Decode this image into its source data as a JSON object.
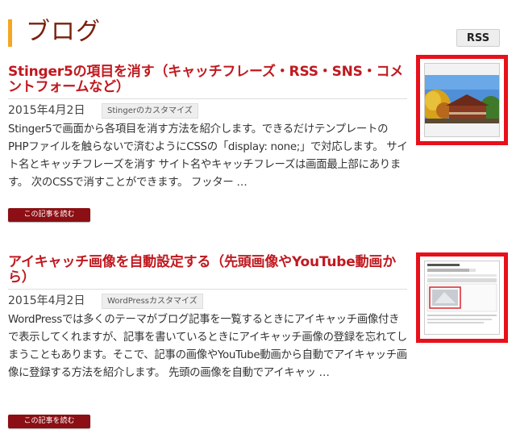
{
  "header": {
    "title": "ブログ",
    "rss_label": "RSS"
  },
  "posts": [
    {
      "title": "Stinger5の項目を消す（キャッチフレーズ・RSS・SNS・コメントフォームなど）",
      "date": "2015年4月2日",
      "category": "Stingerのカスタマイズ",
      "excerpt": "Stinger5で画面から各項目を消す方法を紹介します。できるだけテンプレートのPHPファイルを触らないで済むようにCSSの「display: none;」で対応します。 サイト名とキャッチフレーズを消す サイト名やキャッチフレーズは画面最上部にあります。 次のCSSで消すことができます。 フッター …",
      "read_more": "この記事を読む",
      "thumbnail": "temple-autumn-photo"
    },
    {
      "title": "アイキャッチ画像を自動設定する（先頭画像やYouTube動画から）",
      "date": "2015年4月2日",
      "category": "WordPressカスタマイズ",
      "excerpt": "WordPressでは多くのテーマがブログ記事を一覧するときにアイキャッチ画像付きで表示してくれますが、記事を書いているときにアイキャッチ画像の登録を忘れてしまうこともあります。そこで、記事の画像やYouTube動画から自動でアイキャッチ画像に登録する方法を紹介します。 先頭の画像を自動でアイキャッ …",
      "read_more": "この記事を読む",
      "thumbnail": "editor-screenshot"
    }
  ],
  "colors": {
    "accent_bar": "#f5a623",
    "header_title": "#7a1e0e",
    "post_title": "#c0191f",
    "read_more_bg": "#8b0f14",
    "thumb_highlight": "#e8101a"
  }
}
